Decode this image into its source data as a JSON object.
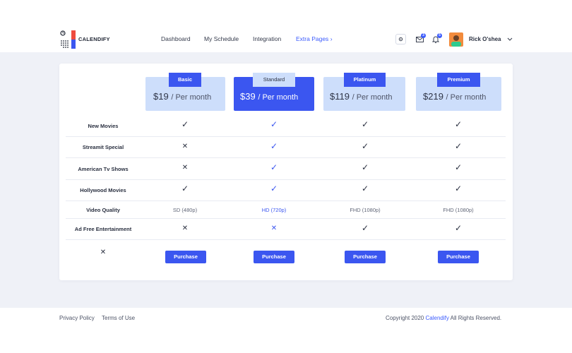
{
  "header": {
    "brand": "CALENDIFY",
    "nav": [
      "Dashboard",
      "My Schedule",
      "Integration"
    ],
    "extra_pages": "Extra Pages",
    "extra_chevron": "›",
    "mail_count": "3",
    "notif_count": "5",
    "username": "Rick O'shea"
  },
  "plans": [
    {
      "name": "Basic",
      "price": "$19",
      "per": "/ Per month"
    },
    {
      "name": "Standard",
      "price": "$39",
      "per": "/ Per month"
    },
    {
      "name": "Platinum",
      "price": "$119",
      "per": "/ Per month"
    },
    {
      "name": "Premium",
      "price": "$219",
      "per": "/ Per month"
    }
  ],
  "features": [
    {
      "label": "New Movies",
      "values": [
        "check",
        "check",
        "check",
        "check"
      ]
    },
    {
      "label": "Streamit Special",
      "values": [
        "cross",
        "check",
        "check",
        "check"
      ]
    },
    {
      "label": "American Tv Shows",
      "values": [
        "cross",
        "check",
        "check",
        "check"
      ]
    },
    {
      "label": "Hollywood Movies",
      "values": [
        "check",
        "check",
        "check",
        "check"
      ]
    },
    {
      "label": "Video Quality",
      "values": [
        "SD (480p)",
        "HD (720p)",
        "FHD (1080p)",
        "FHD (1080p)"
      ]
    },
    {
      "label": "Ad Free Entertainment",
      "values": [
        "cross",
        "cross",
        "check",
        "check"
      ]
    }
  ],
  "purchase_label": "Purchase",
  "last_row_symbol": "✕",
  "footer": {
    "privacy": "Privacy Policy",
    "terms": "Terms of Use",
    "copyright_prefix": "Copyright 2020",
    "copyright_brand": "Calendify",
    "copyright_suffix": "All Rights Reserved."
  },
  "colors": {
    "accent": "#3b56f0",
    "light_plan": "#cddefb",
    "page_bg": "#eff1f7"
  }
}
